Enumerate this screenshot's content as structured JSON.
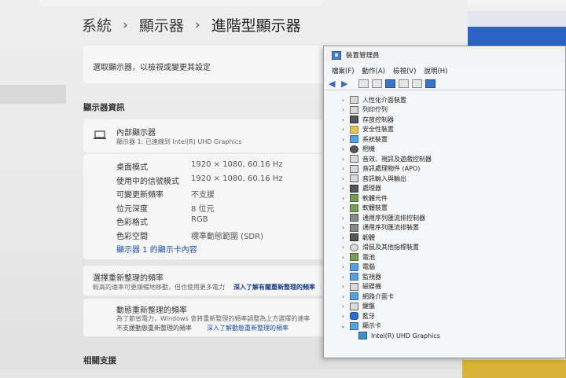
{
  "breadcrumb": {
    "items": [
      "系統",
      "顯示器",
      "進階型顯示器"
    ],
    "separator": "›"
  },
  "select_display": {
    "label": "選取顯示器，以檢視或變更其設定"
  },
  "display_info": {
    "section_title": "顯示器資訊",
    "device_name": "內部顯示器",
    "device_sub": "顯示器 1: 已連線到 Intel(R) UHD Graphics",
    "rows": [
      {
        "label": "桌面模式",
        "value": "1920 × 1080, 60.16 Hz"
      },
      {
        "label": "使用中的信號模式",
        "value": "1920 × 1080, 60.16 Hz"
      },
      {
        "label": "可變更新頻率",
        "value": "不支援"
      },
      {
        "label": "位元深度",
        "value": "8 位元"
      },
      {
        "label": "色彩格式",
        "value": "RGB"
      },
      {
        "label": "色彩空間",
        "value": "標準動態範圍 (SDR)"
      }
    ],
    "adapter_link": "顯示器 1 的顯示卡內容"
  },
  "refresh": {
    "title": "選擇重新整理的頻率",
    "desc": "較高的速率可更順暢地移動，但也使用更多電力",
    "learn_more": "深入了解有關重新整理的頻率",
    "dynamic_title": "動態重新整理的頻率",
    "dynamic_desc": "為了節省電力，Windows 會將重新整理的頻率調整為上方選擇的速率",
    "dynamic_note": "不支援動態重新整理的頻率",
    "dynamic_link": "深入了解動態重新整理的頻率"
  },
  "related": {
    "title": "相關支援"
  },
  "device_manager": {
    "title": "裝置管理員",
    "menu": [
      "檔案(F)",
      "動作(A)",
      "檢視(V)",
      "說明(H)"
    ],
    "tree": [
      {
        "label": "人性化介面裝置",
        "icon": "hid-icon",
        "expanded": false
      },
      {
        "label": "列印佇列",
        "icon": "printer-icon",
        "expanded": false
      },
      {
        "label": "存放控制器",
        "icon": "storage-controller-icon",
        "expanded": false
      },
      {
        "label": "安全性裝置",
        "icon": "security-device-icon",
        "expanded": false
      },
      {
        "label": "系統裝置",
        "icon": "system-device-icon",
        "expanded": false
      },
      {
        "label": "相機",
        "icon": "camera-icon",
        "expanded": false
      },
      {
        "label": "音效、視訊及遊戲控制器",
        "icon": "sound-icon",
        "expanded": false
      },
      {
        "label": "音訊處理物件 (APO)",
        "icon": "audio-apo-icon",
        "expanded": false
      },
      {
        "label": "音訊輸入與輸出",
        "icon": "audio-io-icon",
        "expanded": false
      },
      {
        "label": "處理器",
        "icon": "processor-icon",
        "expanded": false
      },
      {
        "label": "軟體元件",
        "icon": "software-component-icon",
        "expanded": false
      },
      {
        "label": "軟體裝置",
        "icon": "software-device-icon",
        "expanded": false
      },
      {
        "label": "通用序列匯流排控制器",
        "icon": "usb-controller-icon",
        "expanded": false
      },
      {
        "label": "通用序列匯流排裝置",
        "icon": "usb-device-icon",
        "expanded": false
      },
      {
        "label": "韌體",
        "icon": "firmware-icon",
        "expanded": false
      },
      {
        "label": "滑鼠及其他指標裝置",
        "icon": "mouse-icon",
        "expanded": false
      },
      {
        "label": "電池",
        "icon": "battery-icon",
        "expanded": false
      },
      {
        "label": "電腦",
        "icon": "computer-icon",
        "expanded": false
      },
      {
        "label": "監視器",
        "icon": "monitor-icon",
        "expanded": false
      },
      {
        "label": "磁碟機",
        "icon": "disk-drive-icon",
        "expanded": false
      },
      {
        "label": "網路介面卡",
        "icon": "network-adapter-icon",
        "expanded": false
      },
      {
        "label": "鍵盤",
        "icon": "keyboard-icon",
        "expanded": false
      },
      {
        "label": "藍牙",
        "icon": "bluetooth-icon",
        "expanded": false
      },
      {
        "label": "顯示卡",
        "icon": "display-adapter-icon",
        "expanded": true
      }
    ],
    "child": {
      "label": "Intel(R) UHD Graphics",
      "icon": "gpu-icon"
    }
  }
}
